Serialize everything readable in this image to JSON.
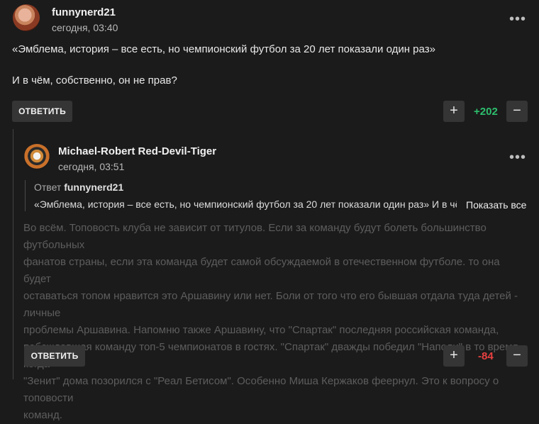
{
  "comment": {
    "username": "funnynerd21",
    "timestamp": "сегодня, 03:40",
    "more": "•••",
    "text_line1": "«Эмблема, история – все есть, но чемпионский футбол за 20 лет показали один раз»",
    "text_line2": "И в чём, собственно, он не прав?",
    "reply_label": "ОТВЕТИТЬ",
    "score": "+202",
    "score_color": "#2dbf6e",
    "plus": "+",
    "minus": "−"
  },
  "reply": {
    "username": "Michael-Robert Red-Devil-Tiger",
    "timestamp": "сегодня, 03:51",
    "more": "•••",
    "quote_prefix": "Ответ",
    "quote_user": "funnynerd21",
    "quote_text": "«Эмблема, история – все есть, но чемпионский футбол за 20 лет показали один раз» И в чём, ...",
    "show_all": "Показать все",
    "body_lines": [
      "Во всём. Топовость клуба не зависит от титулов. Если за команду будут болеть большинство футбольных",
      "фанатов страны, если эта команда будет самой обсуждаемой в отечественном футболе. то она будет",
      "оставаться топом нравится это Аршавину или нет. Боли от того что его бывшая отдала туда детей - личные",
      "проблемы Аршавина. Напомню также Аршавину, что \"Спартак\" последняя российская команда,",
      "побеждавшая команду топ-5 чемпионатов в гостях. \"Спартак\" дважды победил \"Наполи\" в то время когда",
      "\"Зенит\" дома позорился с \"Реал Бетисом\". Особенно Миша Кержаков феернул. Это к вопросу о топовости",
      "команд."
    ],
    "reply_label": "ОТВЕТИТЬ",
    "score": "-84",
    "score_color": "#e84040",
    "plus": "+",
    "minus": "−"
  }
}
